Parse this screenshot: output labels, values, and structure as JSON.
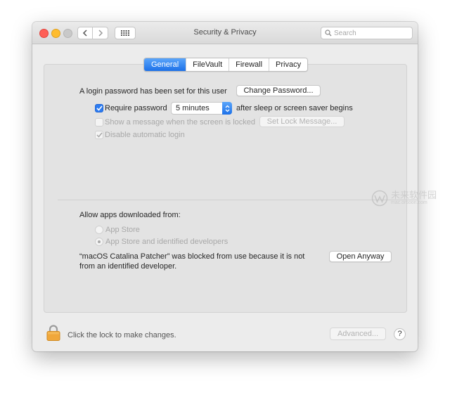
{
  "window": {
    "title": "Security & Privacy"
  },
  "search": {
    "placeholder": "Search"
  },
  "tabs": [
    {
      "label": "General",
      "active": true
    },
    {
      "label": "FileVault",
      "active": false
    },
    {
      "label": "Firewall",
      "active": false
    },
    {
      "label": "Privacy",
      "active": false
    }
  ],
  "general": {
    "login_password_text": "A login password has been set for this user",
    "change_password_button": "Change Password...",
    "require_password": {
      "label": "Require password",
      "checked": true
    },
    "require_interval": "5 minutes",
    "require_suffix": "after sleep or screen saver begins",
    "show_message": {
      "label": "Show a message when the screen is locked",
      "checked": false,
      "enabled": false
    },
    "set_lock_message_button": "Set Lock Message...",
    "disable_auto_login": {
      "label": "Disable automatic login",
      "checked": true,
      "enabled": false
    }
  },
  "downloads": {
    "heading": "Allow apps downloaded from:",
    "options": [
      {
        "label": "App Store",
        "selected": false
      },
      {
        "label": "App Store and identified developers",
        "selected": true
      }
    ],
    "blocked_message_line1": "“macOS Catalina Patcher” was blocked from use because it is not",
    "blocked_message_line2": "from an identified developer.",
    "open_anyway_button": "Open Anyway"
  },
  "footer": {
    "lock_text": "Click the lock to make changes.",
    "advanced_button": "Advanced...",
    "help_label": "?"
  },
  "watermark": {
    "text": "未来软件园",
    "subtext": "mac.orsoon.com"
  },
  "colors": {
    "accent": "#1d71e8",
    "close": "#fe5f57",
    "minimize": "#febc2e",
    "lock": "#f0a73a"
  }
}
